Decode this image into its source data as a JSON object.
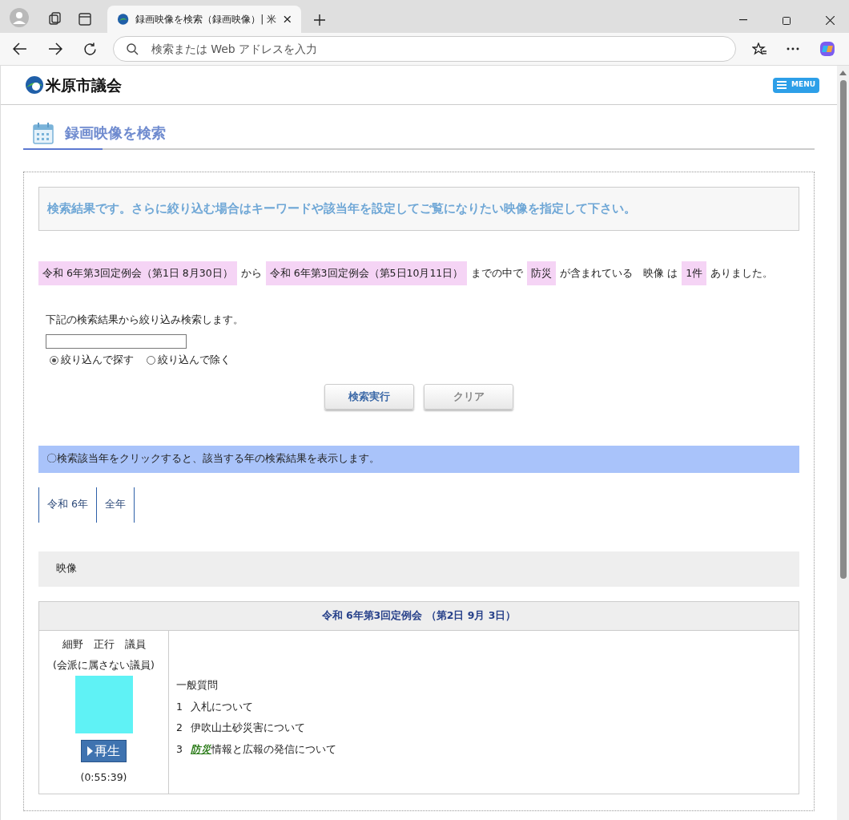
{
  "browser": {
    "tab_title": "録画映像を検索（録画映像）| 米",
    "address_placeholder": "検索または Web アドレスを入力"
  },
  "site": {
    "logo": "米原市議会",
    "menu": "MENU"
  },
  "page_title": "録画映像を検索",
  "notice": "検索結果です。さらに絞り込む場合はキーワードや該当年を設定してご覧になりたい映像を指定して下さい。",
  "summary": [
    {
      "kind": "highlight",
      "text": "令和 6年第3回定例会（第1日 8月30日）"
    },
    {
      "kind": "plain",
      "text": "から"
    },
    {
      "kind": "highlight",
      "text": "令和 6年第3回定例会（第5日10月11日）"
    },
    {
      "kind": "plain",
      "text": "までの中で"
    },
    {
      "kind": "highlight",
      "text": "防災"
    },
    {
      "kind": "plain",
      "text": "が含まれている　映像 は"
    },
    {
      "kind": "highlight",
      "text": "1件"
    },
    {
      "kind": "plain",
      "text": "ありました。"
    }
  ],
  "refine": {
    "label": "下記の検索結果から絞り込み検索します。",
    "options": [
      {
        "label": "絞り込んで探す",
        "selected": true
      },
      {
        "label": "絞り込んで除く",
        "selected": false
      }
    ],
    "buttons": [
      {
        "label": "検索実行",
        "kind": "primary"
      },
      {
        "label": "クリア",
        "kind": "secondary"
      }
    ]
  },
  "year_info": "〇検索該当年をクリックすると、該当する年の検索結果を表示します。",
  "year_tabs": [
    "令和 6年",
    "全年"
  ],
  "section": "映像",
  "results": [
    {
      "session": "令和 6年第3回定例会 （第2日 9月 3日）",
      "speaker": "細野　正行　議員",
      "faction": "(会派に属さない議員)",
      "play": "再生",
      "duration": "(0:55:39)",
      "lines": [
        {
          "text": "一般質問"
        },
        {
          "number": "1",
          "text": "入札について"
        },
        {
          "number": "2",
          "text": "伊吹山土砂災害について"
        },
        {
          "number": "3",
          "keyword": "防災",
          "text": "情報と広報の発信について"
        }
      ]
    }
  ]
}
